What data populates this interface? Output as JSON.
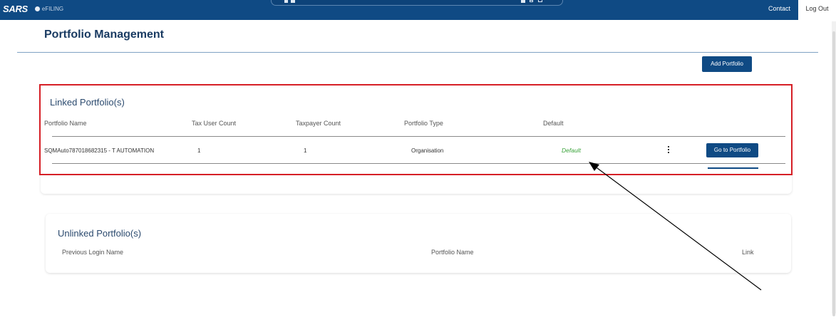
{
  "header": {
    "logo_text": "SARS",
    "efiling_text": "eFILING",
    "contact_label": "Contact",
    "logout_label": "Log Out"
  },
  "page": {
    "title": "Portfolio Management",
    "add_portfolio_label": "Add Portfolio"
  },
  "linked": {
    "title": "Linked Portfolio(s)",
    "columns": [
      "Portfolio Name",
      "Tax User Count",
      "Taxpayer Count",
      "Portfolio Type",
      "Default"
    ],
    "rows": [
      {
        "portfolio_name": "SQMAuto787018682315 - T AUTOMATION",
        "tax_user_count": "1",
        "taxpayer_count": "1",
        "portfolio_type": "Organisation",
        "default": "Default",
        "action_label": "Go to Portfolio"
      }
    ]
  },
  "unlinked": {
    "title": "Unlinked Portfolio(s)",
    "columns": [
      "Previous Login Name",
      "Portfolio Name",
      "Link"
    ]
  },
  "colors": {
    "brand": "#0f4a84",
    "highlight": "#d61f26",
    "default_green": "#3aa33a"
  }
}
